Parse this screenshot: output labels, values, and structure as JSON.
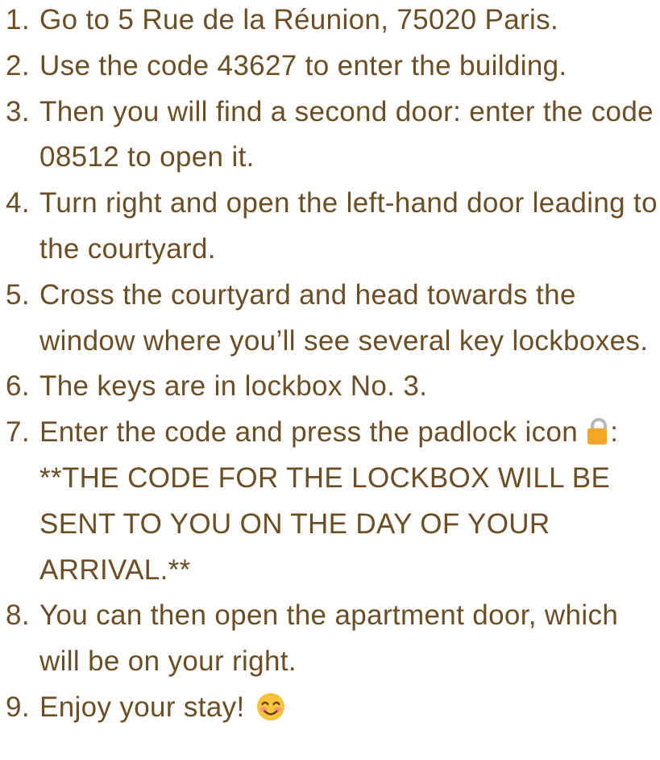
{
  "colors": {
    "text": "#6b4e24",
    "lock_body": "#f6a623",
    "lock_shackle": "#b7b7b7",
    "emoji_face": "#f7c33a"
  },
  "steps": [
    {
      "num": "1.",
      "text": "Go to 5 Rue de la Réunion, 75020 Paris."
    },
    {
      "num": "2.",
      "text": "Use the code 43627 to enter the building."
    },
    {
      "num": "3.",
      "text": "Then you will find a second door: enter the code 08512 to open it."
    },
    {
      "num": "4.",
      "text": "Turn right and open the left-hand door leading to the courtyard."
    },
    {
      "num": "5.",
      "text": "Cross the courtyard and head towards the window where you’ll see several key lockboxes."
    },
    {
      "num": "6.",
      "text": "The keys are in lockbox No. 3."
    },
    {
      "num": "7.",
      "text": "Enter the code and press the padlock icon",
      "text_after_icon": ": **THE CODE FOR THE LOCKBOX WILL BE SENT TO YOU ON THE DAY OF YOUR ARRIVAL.**",
      "icon": "padlock-icon"
    },
    {
      "num": "8.",
      "text": "You can then open the apartment door, which will be on your right."
    },
    {
      "num": "9.",
      "text": "Enjoy your stay!",
      "icon": "smiling-face-icon"
    }
  ]
}
